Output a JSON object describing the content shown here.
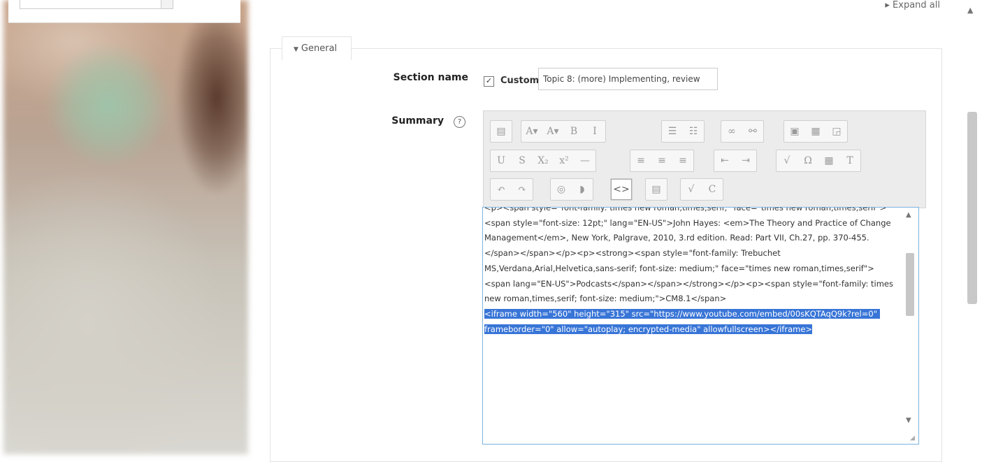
{
  "header": {
    "expand_all": "Expand all"
  },
  "general": {
    "legend": "General",
    "section_name_label": "Section name",
    "custom_label": "Custom",
    "custom_checked": true,
    "section_name_value": "Topic 8: (more) Implementing, review",
    "summary_label": "Summary",
    "help_symbol": "?"
  },
  "editor": {
    "text_before_selection": "<p><span style=\"font-family: times new roman,times,serif;\" face=\"times new roman,times,serif\"><span style=\"font-size: 12pt;\" lang=\"EN-US\">John Hayes: <em>The Theory and Practice of Change Management</em>, New York, Palgrave, 2010, 3.rd edition. Read: Part VII, Ch.27, pp. 370-455.</span></span></p><p><strong><span style=\"font-family: Trebuchet MS,Verdana,Arial,Helvetica,sans-serif; font-size: medium;\" face=\"times new roman,times,serif\"><span lang=\"EN-US\">Podcasts</span></span></strong></p><p><span style=\"font-family: times new roman,times,serif; font-size: medium;\">CM8.1</span>\n",
    "selected_text": "<iframe width=\"560\" height=\"315\" src=\"https://www.youtube.com/embed/00sKQTAqQ9k?rel=0\" frameborder=\"0\" allow=\"autoplay; encrypted-media\" allowfullscreen></iframe>"
  },
  "toolbar": {
    "row1": [
      "save-icon",
      "font-size-icon",
      "font-color-icon",
      "bold-icon",
      "italic-icon",
      "bullet-list-icon",
      "numbered-list-icon",
      "link-icon",
      "unlink-icon",
      "image-icon",
      "media-icon",
      "manage-files-icon"
    ],
    "row2": [
      "underline-icon",
      "strikethrough-icon",
      "subscript-icon",
      "superscript-icon",
      "horizontal-rule-icon",
      "align-left-icon",
      "align-center-icon",
      "align-right-icon",
      "outdent-icon",
      "indent-icon",
      "equation-icon",
      "special-char-icon",
      "table-icon",
      "clear-format-icon"
    ],
    "row3": [
      "undo-icon",
      "redo-icon",
      "accessibility-checker-icon",
      "screenreader-helper-icon",
      "html-source-icon",
      "paste-text-icon",
      "spellcheck-icon",
      "cloze-icon"
    ]
  }
}
